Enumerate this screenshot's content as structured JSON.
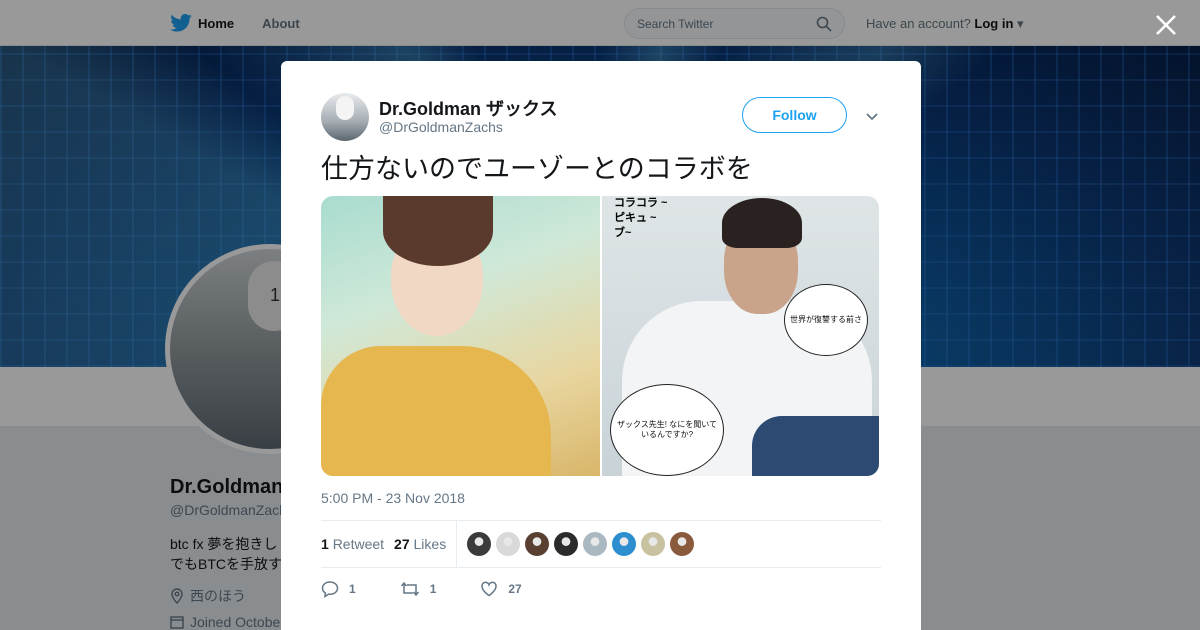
{
  "nav": {
    "home_label": "Home",
    "about_label": "About",
    "search_placeholder": "Search Twitter",
    "account_prompt": "Have an account?",
    "login_label": "Log in"
  },
  "profile": {
    "avatar_text": "1",
    "name": "Dr.Goldman",
    "handle": "@DrGoldmanZach",
    "bio_line1": "btc fx 夢を抱きし",
    "bio_line2": "でもBTCを手放す",
    "location": "西のほう",
    "joined": "Joined Octobe"
  },
  "tweet": {
    "author_name": "Dr.Goldman ザックス",
    "author_handle": "@DrGoldmanZachs",
    "follow_label": "Follow",
    "text": "仕方ないのでユーゾーとのコラボを",
    "media": {
      "scribble_line1": "コラコラ ~",
      "scribble_line2": "ピキュ ~",
      "scribble_line3": "ブ~",
      "bubble1": "世界が復讐する前さ",
      "bubble2": "ザックス先生! なにを聞いているんですか?"
    },
    "timestamp": "5:00 PM - 23 Nov 2018",
    "retweet_count": "1",
    "retweet_label": "Retweet",
    "like_count": "27",
    "like_label": "Likes",
    "likers": [
      "#3b3b3b",
      "#d9d9d9",
      "#5a4030",
      "#2b2b2b",
      "#aab8c2",
      "#2e8fd0",
      "#c9c2a0",
      "#8a5a3c"
    ],
    "actions": {
      "reply_count": "1",
      "retweet_count": "1",
      "like_count": "27"
    }
  },
  "colors": {
    "accent": "#1da1f2",
    "text_secondary": "#657786"
  }
}
